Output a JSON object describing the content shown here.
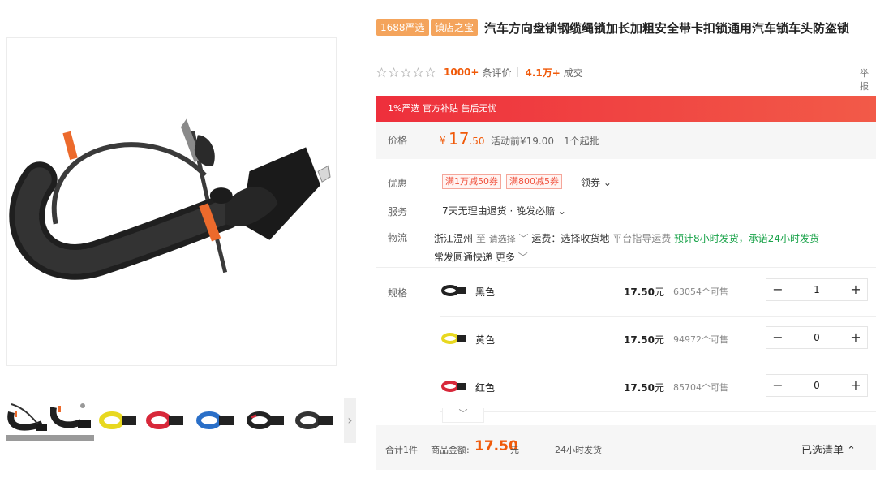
{
  "badges": {
    "b1688": "1688严选",
    "shop": "镇店之宝"
  },
  "title": "汽车方向盘锁钢缆绳锁加长加粗安全带卡扣锁通用汽车锁车头防盗锁",
  "rating": {
    "stars_filled": 0,
    "reviews_count": "1000+",
    "reviews_label": "条评价",
    "sales_count": "4.1万+",
    "sales_label": "成交"
  },
  "report_label": "举报",
  "promo_bar": "1%严选 官方补贴 售后无忧",
  "price": {
    "label": "价格",
    "currency": "¥",
    "integer": "17",
    "decimal": ".50",
    "before": "活动前¥19.00",
    "moq": "1个起批"
  },
  "coupons": {
    "label": "优惠",
    "items": [
      "满1万减50券",
      "满800减5券"
    ],
    "get_label": "领券 ⌄"
  },
  "service": {
    "label": "服务",
    "text": "7天无理由退货 · 晚发必赔 ⌄"
  },
  "logistics": {
    "label": "物流",
    "origin": "浙江温州",
    "to": "至",
    "select": "请选择",
    "freight_label": "运费：选择收货地",
    "guide": "平台指导运费",
    "promise": "预计8小时发货，承诺24小时发货",
    "courier": "常发圆通快递",
    "more": "更多"
  },
  "specs": {
    "label": "规格",
    "items": [
      {
        "name": "黑色",
        "price": "17.50",
        "unit": "元",
        "stock": "63054个可售",
        "qty": "1",
        "color": "#222222"
      },
      {
        "name": "黄色",
        "price": "17.50",
        "unit": "元",
        "stock": "94972个可售",
        "qty": "0",
        "color": "#e8d820"
      },
      {
        "name": "红色",
        "price": "17.50",
        "unit": "元",
        "stock": "85704个可售",
        "qty": "0",
        "color": "#d8283a"
      }
    ]
  },
  "cart": {
    "total": "合计1件",
    "amount_label": "商品金额:",
    "amount": "17.50",
    "amount_unit": "元",
    "ship": "24小时发货",
    "chosen": "已选清单 ⌃"
  },
  "colors": {
    "accent": "#f05a0a",
    "promo": "#ee2f3c",
    "green": "#1aa34a",
    "badge": "#f4a45c"
  }
}
